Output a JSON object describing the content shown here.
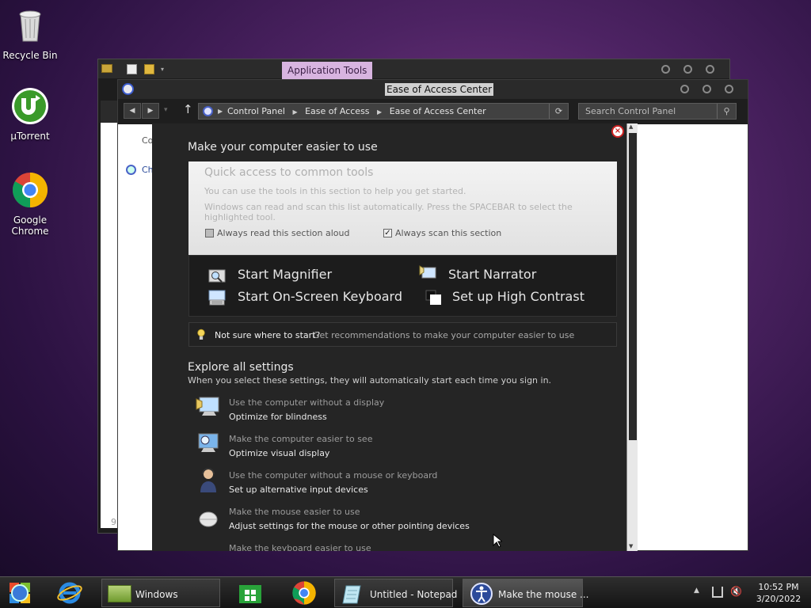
{
  "desktop": {
    "icons": [
      {
        "label": "Recycle Bin"
      },
      {
        "label": "µTorrent"
      },
      {
        "label": "Google Chrome"
      }
    ]
  },
  "back_window": {
    "ribbon_tab": "Application Tools",
    "left_text_1": "Co",
    "left_text_2": "Ch",
    "left_text_3": "9"
  },
  "window": {
    "title": "Ease of Access Center",
    "address": {
      "parts": [
        "Control Panel",
        "Ease of Access",
        "Ease of Access Center"
      ]
    },
    "search_placeholder": "Search Control Panel"
  },
  "dialog": {
    "heading": "Make your computer easier to use",
    "quick_access": {
      "title": "Quick access to common tools",
      "line1": "You can use the tools in this section to help you get started.",
      "line2": "Windows can read and scan this list automatically.  Press the SPACEBAR to select the highlighted tool.",
      "read_aloud_label": "Always read this section aloud",
      "read_aloud_checked": false,
      "scan_label": "Always scan this section",
      "scan_checked": true
    },
    "tools": {
      "magnifier": "Start Magnifier",
      "narrator": "Start Narrator",
      "keyboard": "Start On-Screen Keyboard",
      "contrast": "Set up High Contrast"
    },
    "hint": {
      "bold": "Not sure where to start?",
      "link": "Get recommendations to make your computer easier to use"
    },
    "explore": {
      "title": "Explore all settings",
      "subtitle": "When you select these settings, they will automatically start each time you sign in.",
      "items": [
        {
          "desc": "Use the computer without a display",
          "link": "Optimize for blindness"
        },
        {
          "desc": "Make the computer easier to see",
          "link": "Optimize visual display"
        },
        {
          "desc": "Use the computer without a mouse or keyboard",
          "link": "Set up alternative input devices"
        },
        {
          "desc": "Make the mouse easier to use",
          "link": "Adjust settings for the mouse or other pointing devices"
        },
        {
          "desc": "Make the keyboard easier to use",
          "link": ""
        }
      ]
    }
  },
  "taskbar": {
    "items": [
      {
        "label": "Windows"
      },
      {
        "label": "Untitled - Notepad"
      },
      {
        "label": "Make the mouse ..."
      }
    ],
    "clock": {
      "time": "10:52 PM",
      "date": "3/20/2022"
    }
  }
}
